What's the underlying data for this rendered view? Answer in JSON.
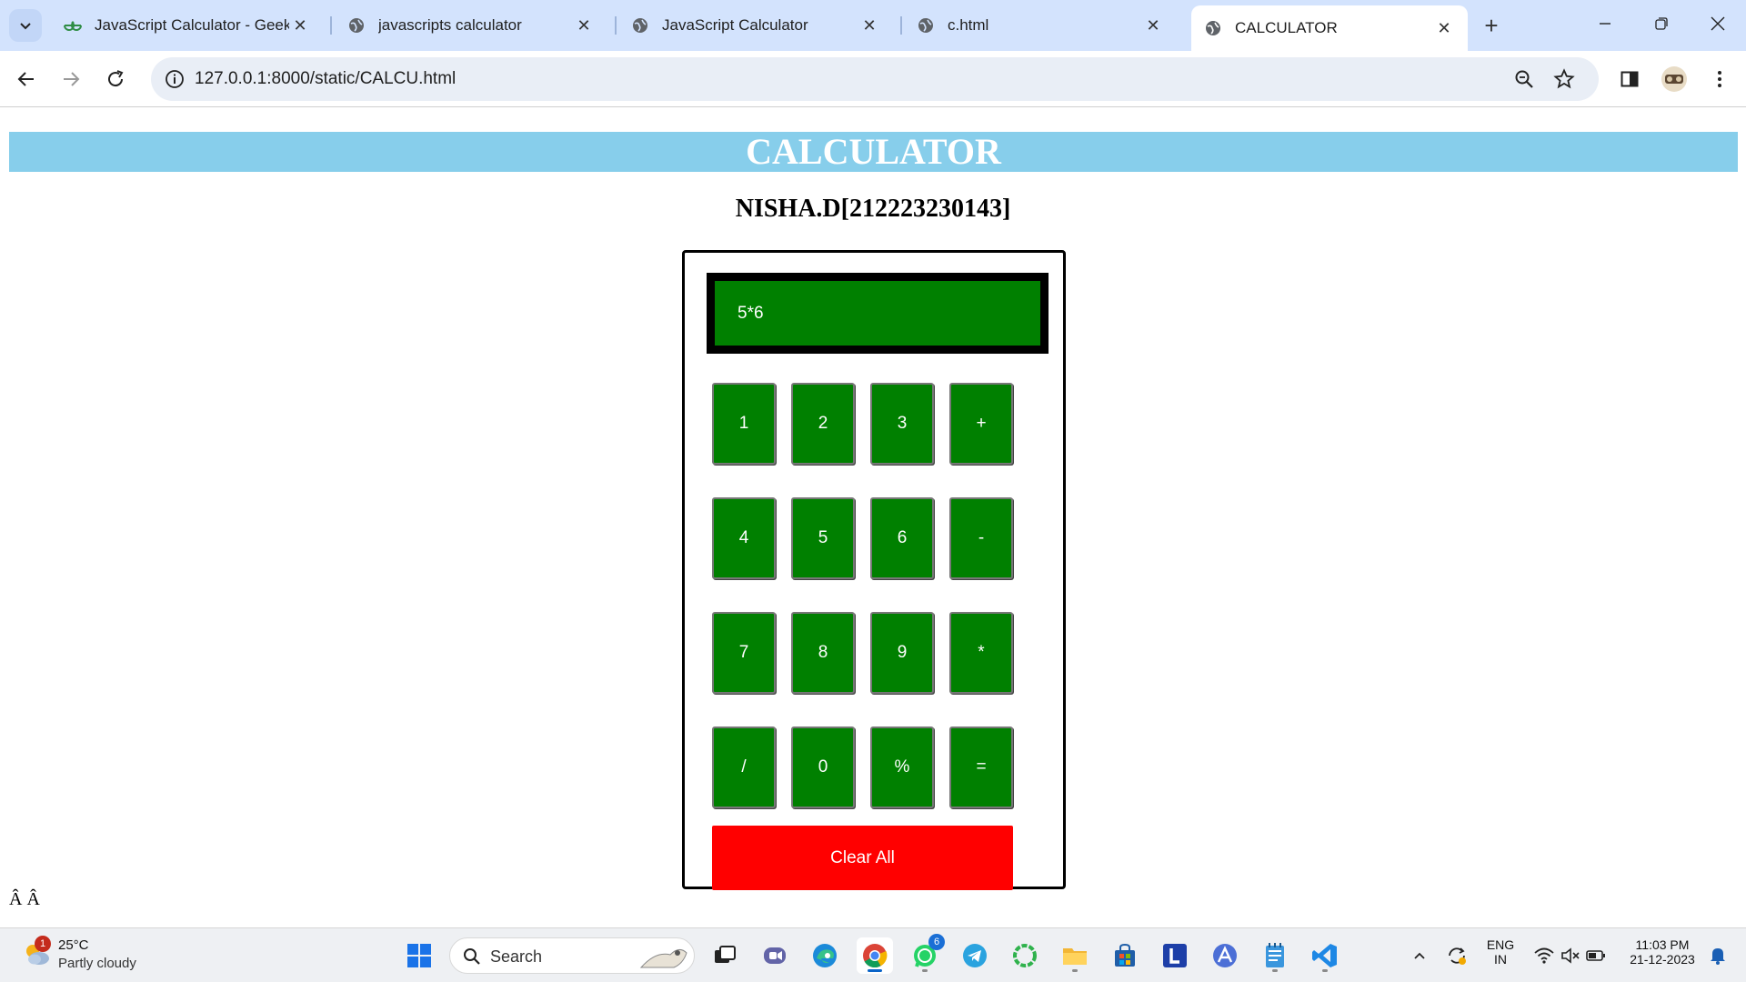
{
  "browser": {
    "tabs": [
      {
        "title": "JavaScript Calculator - GeeksforGeeks",
        "favicon": "geeksforgeeks-icon",
        "active": false
      },
      {
        "title": "javascripts calculator",
        "favicon": "globe-icon",
        "active": false
      },
      {
        "title": "JavaScript Calculator",
        "favicon": "globe-icon",
        "active": false
      },
      {
        "title": "c.html",
        "favicon": "globe-icon",
        "active": false
      },
      {
        "title": "CALCULATOR",
        "favicon": "globe-icon",
        "active": true
      }
    ],
    "url": "127.0.0.1:8000/static/CALCU.html"
  },
  "page": {
    "banner_title": "CALCULATOR",
    "author": "NISHA.D[212223230143]",
    "display_value": "5*6",
    "keys": [
      "1",
      "2",
      "3",
      "+",
      "4",
      "5",
      "6",
      "-",
      "7",
      "8",
      "9",
      "*",
      "/",
      "0",
      "%",
      "="
    ],
    "clear_label": "Clear All",
    "footer_text": "Â Â"
  },
  "colors": {
    "banner": "#87ceeb",
    "key": "#008000",
    "clear": "#ff0000",
    "tabstrip": "#d3e3fd"
  },
  "taskbar": {
    "weather_temp": "25°C",
    "weather_desc": "Partly cloudy",
    "weather_badge": "1",
    "search_label": "Search",
    "whatsapp_badge": "6",
    "lang_top": "ENG",
    "lang_bottom": "IN",
    "time": "11:03 PM",
    "date": "21-12-2023"
  }
}
